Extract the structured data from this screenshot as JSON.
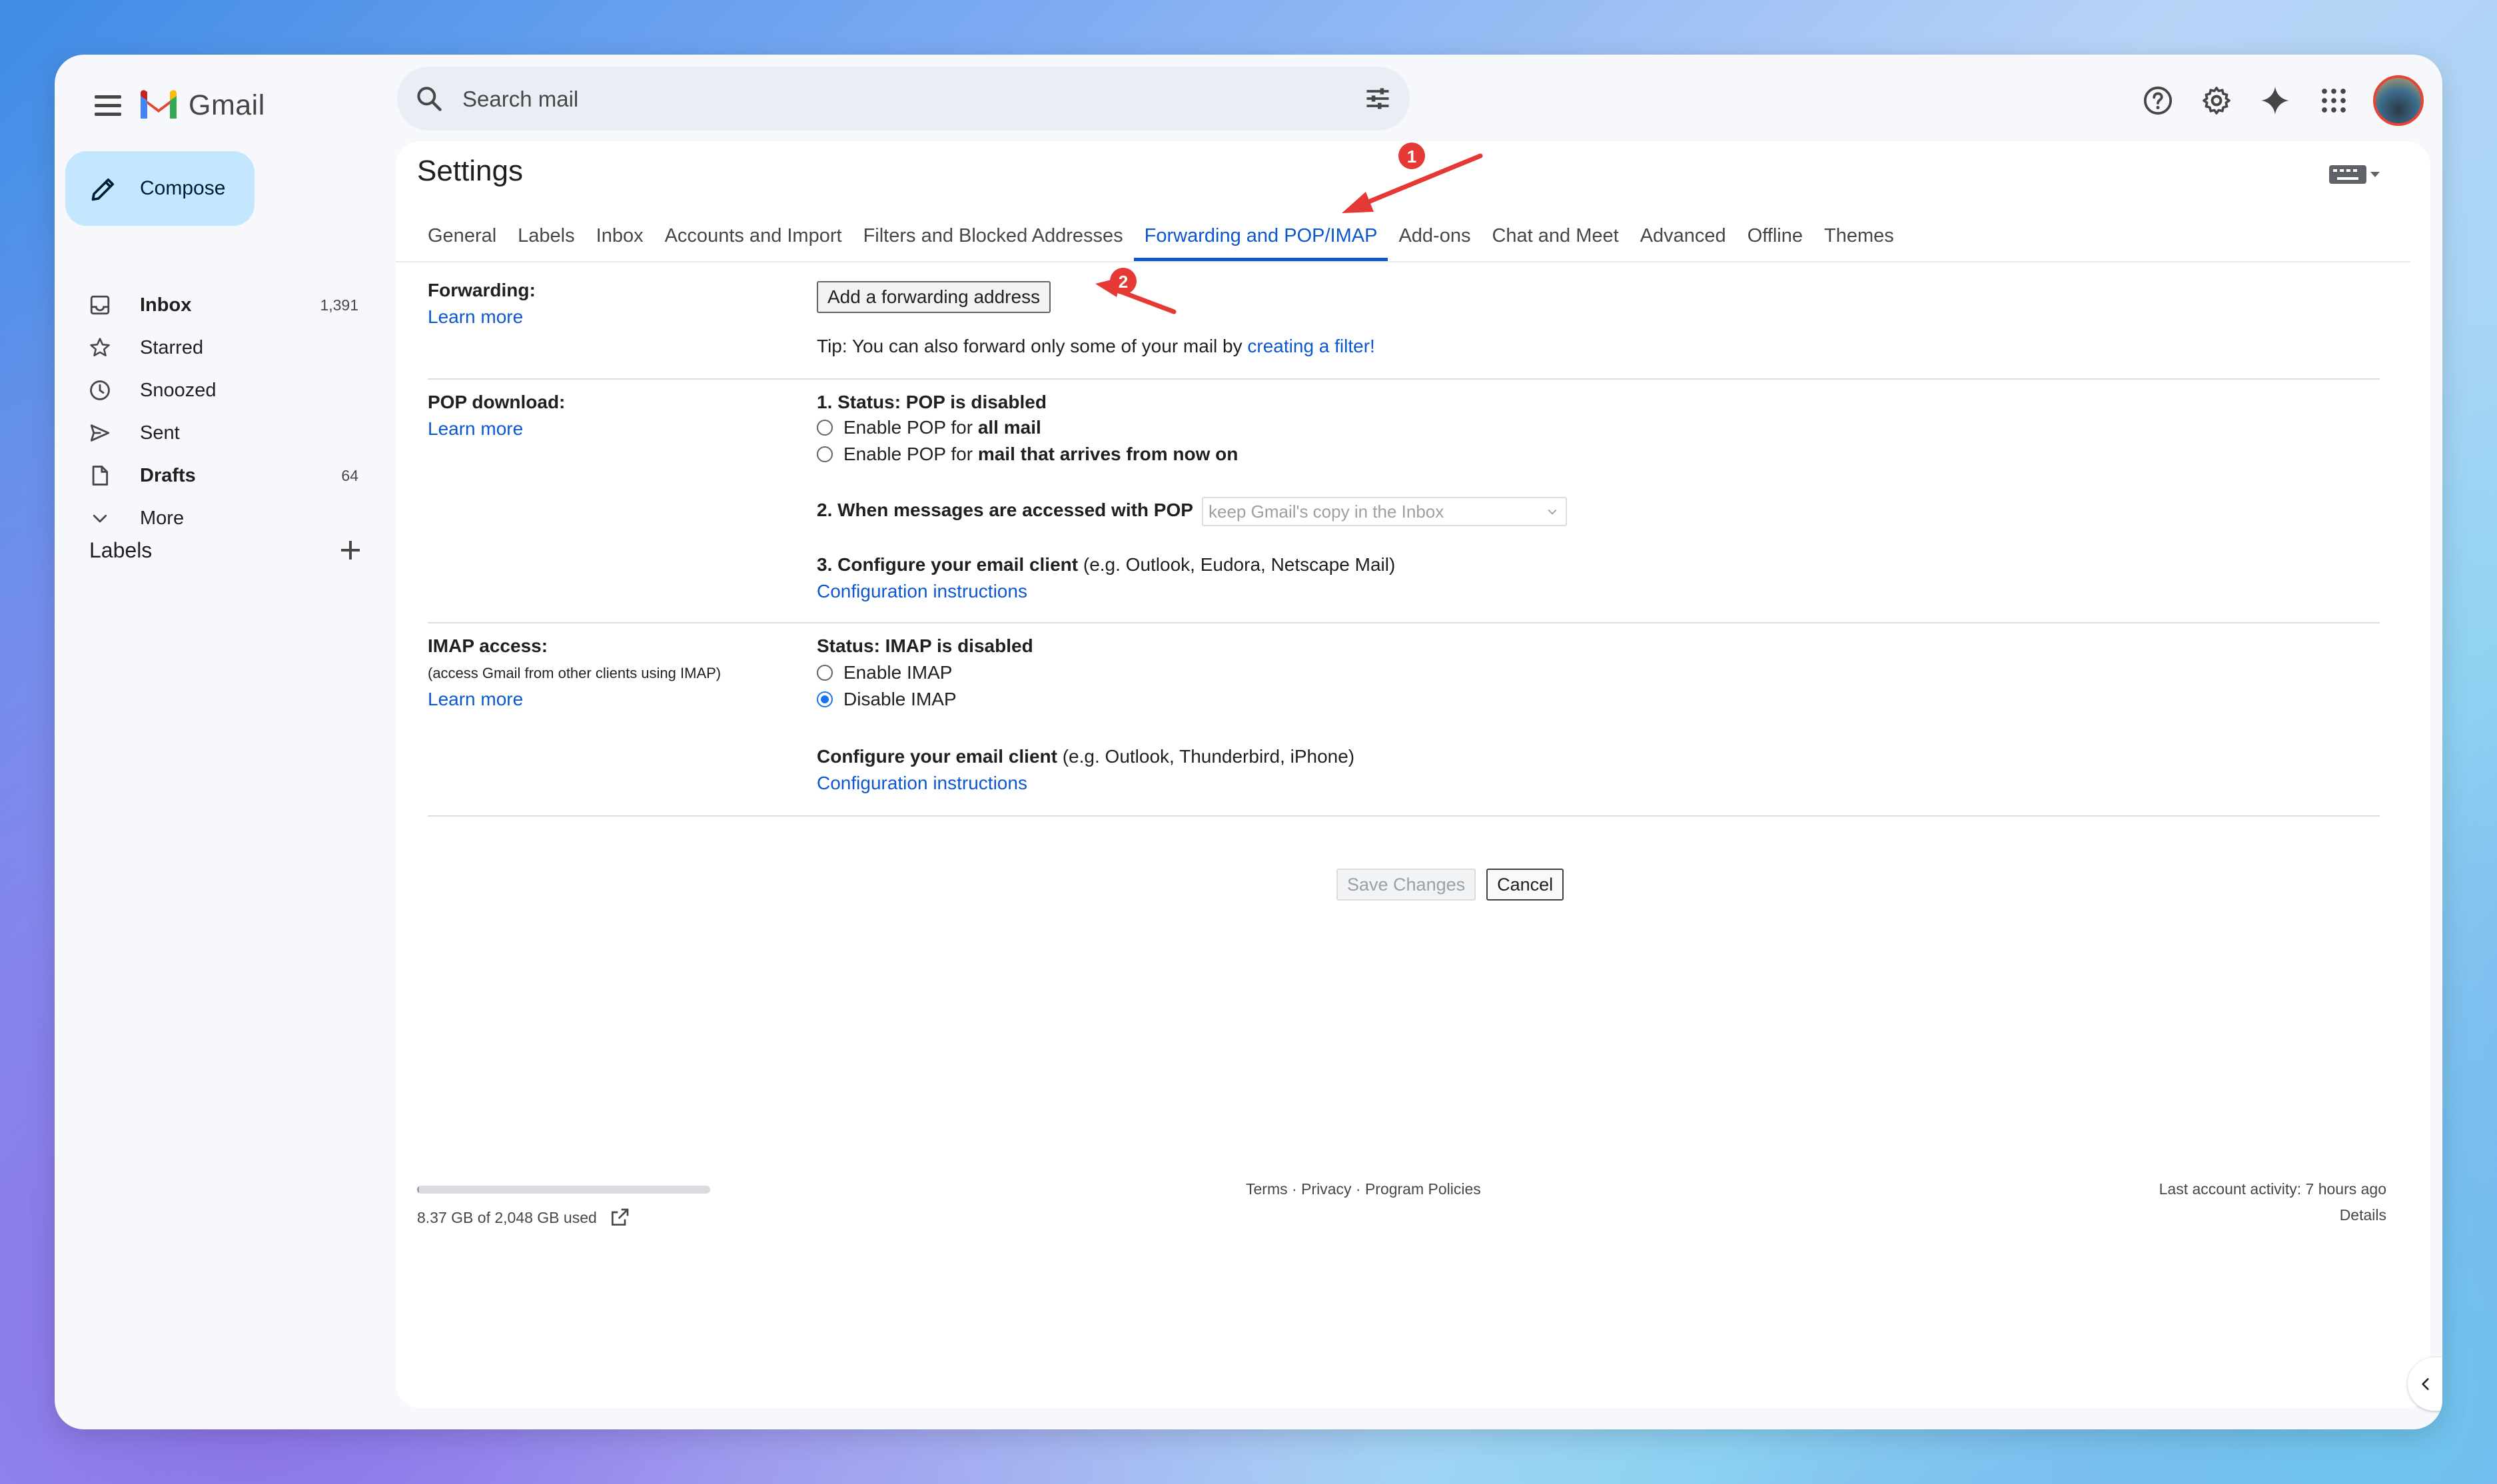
{
  "app": {
    "name": "Gmail"
  },
  "search": {
    "placeholder": "Search mail"
  },
  "sidebar": {
    "compose_label": "Compose",
    "items": [
      {
        "label": "Inbox",
        "count": "1,391",
        "bold": true
      },
      {
        "label": "Starred",
        "count": ""
      },
      {
        "label": "Snoozed",
        "count": ""
      },
      {
        "label": "Sent",
        "count": ""
      },
      {
        "label": "Drafts",
        "count": "64",
        "bold": true
      },
      {
        "label": "More",
        "count": ""
      }
    ],
    "labels_heading": "Labels"
  },
  "settings": {
    "title": "Settings",
    "tabs": [
      "General",
      "Labels",
      "Inbox",
      "Accounts and Import",
      "Filters and Blocked Addresses",
      "Forwarding and POP/IMAP",
      "Add-ons",
      "Chat and Meet",
      "Advanced",
      "Offline",
      "Themes"
    ],
    "active_tab": "Forwarding and POP/IMAP",
    "forwarding": {
      "label": "Forwarding:",
      "learn_more": "Learn more",
      "button": "Add a forwarding address",
      "tip_prefix": "Tip: You can also forward only some of your mail by ",
      "tip_link": "creating a filter!"
    },
    "pop": {
      "label": "POP download:",
      "learn_more": "Learn more",
      "status": "1. Status: POP is disabled",
      "opt1_prefix": "Enable POP for ",
      "opt1_bold": "all mail",
      "opt2_prefix": "Enable POP for ",
      "opt2_bold": "mail that arrives from now on",
      "step2_label": "2. When messages are accessed with POP",
      "step2_value": "keep Gmail's copy in the Inbox",
      "step3_bold": "3. Configure your email client",
      "step3_rest": " (e.g. Outlook, Eudora, Netscape Mail)",
      "config_link": "Configuration instructions"
    },
    "imap": {
      "label": "IMAP access:",
      "sublabel": "(access Gmail from other clients using IMAP)",
      "learn_more": "Learn more",
      "status": "Status: IMAP is disabled",
      "opt_enable": "Enable IMAP",
      "opt_disable": "Disable IMAP",
      "selected": "Disable IMAP",
      "configure_bold": "Configure your email client",
      "configure_rest": " (e.g. Outlook, Thunderbird, iPhone)",
      "config_link": "Configuration instructions"
    },
    "save_label": "Save Changes",
    "cancel_label": "Cancel"
  },
  "footer": {
    "storage_text": "8.37 GB of 2,048 GB used",
    "storage_fraction": 0.004,
    "terms": "Terms",
    "privacy": "Privacy",
    "program_policies": "Program Policies",
    "sep": " · ",
    "activity": "Last account activity: 7 hours ago",
    "details": "Details"
  },
  "annotations": {
    "marker1": "1",
    "marker2": "2",
    "color": "#e53935"
  },
  "colors": {
    "accent": "#0b57d0",
    "compose_bg": "#c2e7ff",
    "app_bg": "#f6f8fc"
  }
}
